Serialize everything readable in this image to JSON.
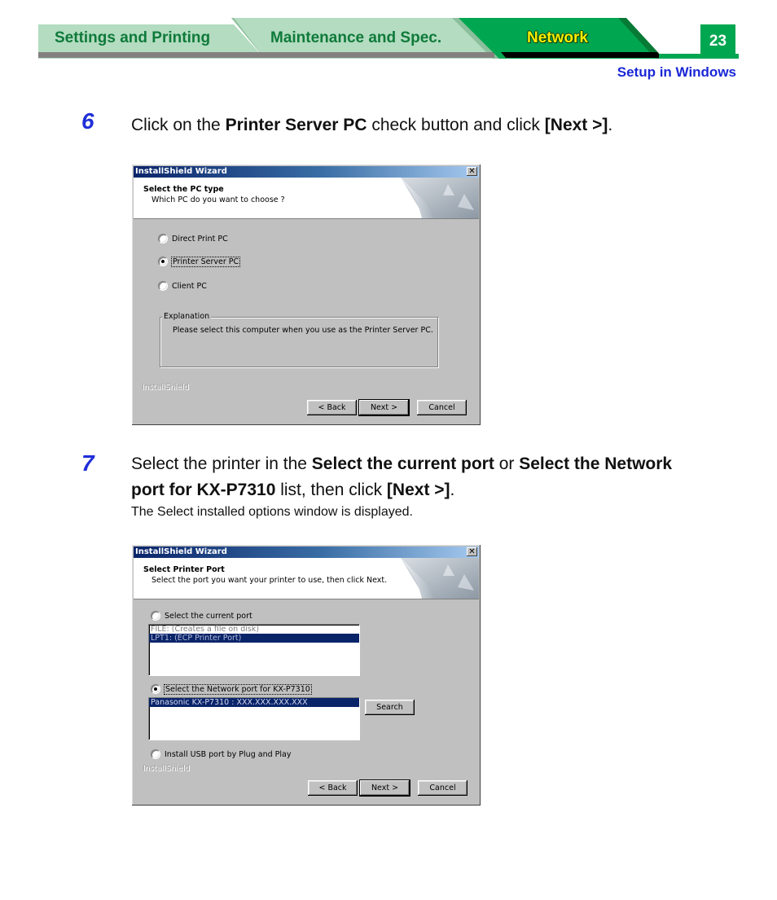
{
  "header": {
    "tabs": [
      {
        "label": "Settings and Printing",
        "active": false
      },
      {
        "label": "Maintenance and Spec.",
        "active": false
      },
      {
        "label": "Network",
        "active": true
      }
    ],
    "page_number": "23",
    "section_link": "Setup in Windows",
    "colors": {
      "tab_inactive": "#b3dcc0",
      "tab_active": "#00a650",
      "tab_text": "#0f7a3a",
      "active_text": "#f7f000",
      "link": "#1a27d6"
    }
  },
  "steps": [
    {
      "number": "6",
      "text_parts": [
        {
          "t": "Click on the ",
          "b": false
        },
        {
          "t": "Printer Server PC",
          "b": true
        },
        {
          "t": " check button and click ",
          "b": false
        },
        {
          "t": "[Next >]",
          "b": true
        },
        {
          "t": ".",
          "b": false
        }
      ],
      "dialog": {
        "title": "InstallShield Wizard",
        "close_glyph": "✕",
        "banner_title": "Select the PC type",
        "banner_subtitle": "Which PC do you want to choose ?",
        "options": [
          {
            "label": "Direct Print PC",
            "checked": false
          },
          {
            "label": "Printer Server PC",
            "checked": true
          },
          {
            "label": "Client PC",
            "checked": false
          }
        ],
        "group_label": "Explanation",
        "group_text": "Please select this computer when you use as the Printer Server PC.",
        "brand": "InstallShield",
        "buttons": {
          "back": "< Back",
          "next": "Next >",
          "cancel": "Cancel"
        }
      }
    },
    {
      "number": "7",
      "text_line1_parts": [
        {
          "t": "Select the printer in the ",
          "b": false
        },
        {
          "t": "Select the current port",
          "b": true
        },
        {
          "t": " or ",
          "b": false
        },
        {
          "t": "Select the Network",
          "b": true
        }
      ],
      "text_line2_parts": [
        {
          "t": "port for KX-P7310",
          "b": true
        },
        {
          "t": " list, then click ",
          "b": false
        },
        {
          "t": "[Next >]",
          "b": true
        },
        {
          "t": ".",
          "b": false
        }
      ],
      "subtext": "The Select installed options window is displayed.",
      "dialog": {
        "title": "InstallShield Wizard",
        "close_glyph": "✕",
        "banner_title": "Select Printer Port",
        "banner_subtitle": "Select the port you want your printer to use, then click Next.",
        "option_current": {
          "label": "Select the current port",
          "checked": false
        },
        "current_ports": [
          {
            "label": "FILE: (Creates a file on disk)",
            "selected": false
          },
          {
            "label": "LPT1: (ECP Printer Port)",
            "selected": true
          }
        ],
        "option_network": {
          "label": "Select the Network port for KX-P7310",
          "checked": true
        },
        "network_ports": [
          {
            "label": "Panasonic KX-P7310 : XXX.XXX.XXX.XXX",
            "selected": true
          }
        ],
        "search_button": "Search",
        "option_usb": {
          "label": "Install USB port by Plug and Play",
          "checked": false
        },
        "brand": "InstallShield",
        "buttons": {
          "back": "< Back",
          "next": "Next >",
          "cancel": "Cancel"
        }
      }
    }
  ]
}
